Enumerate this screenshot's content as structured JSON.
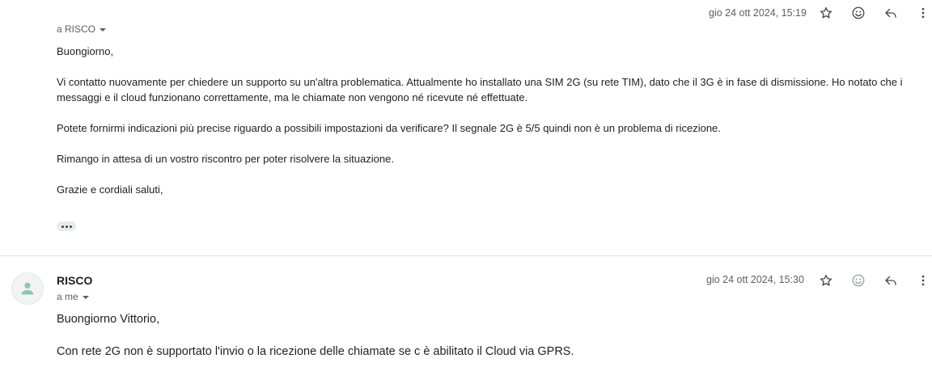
{
  "message1": {
    "date": "gio 24 ott 2024, 15:19",
    "recipient": "a RISCO",
    "body": [
      "Buongiorno,",
      "Vi contatto nuovamente per chiedere un supporto su un'altra problematica. Attualmente ho installato una SIM 2G (su rete TIM), dato che il 3G è in fase di dismissione. Ho notato che i messaggi e il cloud funzionano correttamente, ma le chiamate non vengono né ricevute né effettuate.",
      "Potete fornirmi indicazioni più precise riguardo a possibili impostazioni da verificare? Il segnale 2G è 5/5 quindi non è un problema di ricezione.",
      "Rimango in attesa di un vostro riscontro per poter risolvere la situazione.",
      "Grazie e cordiali saluti,"
    ],
    "icons": {
      "star": "star-icon",
      "emoji": "emoji-icon",
      "reply": "reply-icon",
      "more": "more-vert-icon",
      "trimmed": "show-trimmed-content-icon"
    }
  },
  "message2": {
    "sender": "RISCO",
    "recipient": "a me",
    "date": "gio 24 ott 2024, 15:30",
    "body": [
      "Buongiorno Vittorio,",
      "Con rete 2G non è supportato l'invio o la ricezione delle chiamate se c è abilitato il Cloud via GPRS."
    ],
    "avatar": {
      "icon": "person-icon",
      "color": "#8fc9a8"
    }
  },
  "colors": {
    "text": "#222222",
    "meta": "#5e5e5e",
    "icon": "#444746",
    "divider": "#e3e3e3"
  }
}
